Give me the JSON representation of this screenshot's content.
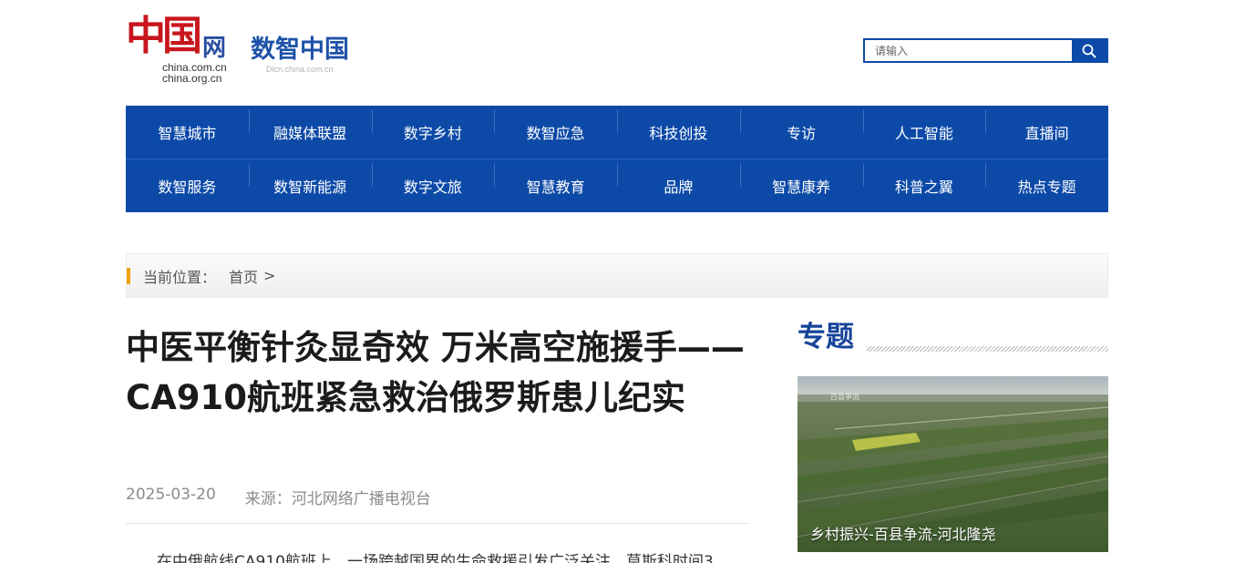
{
  "header": {
    "logo_mark": "中国",
    "logo_wang": "网",
    "domain1": "china.com.cn",
    "domain2": "china.org.cn",
    "site_name": "数智中国",
    "site_domain": "Dicn.china.com.cn"
  },
  "search": {
    "placeholder": "请输入",
    "icon": "search-icon"
  },
  "nav": {
    "row1": [
      "智慧城市",
      "融媒体联盟",
      "数字乡村",
      "数智应急",
      "科技创投",
      "专访",
      "人工智能",
      "直播间"
    ],
    "row2": [
      "数智服务",
      "数智新能源",
      "数字文旅",
      "智慧教育",
      "品牌",
      "智慧康养",
      "科普之翼",
      "热点专题"
    ]
  },
  "breadcrumb": {
    "label": "当前位置：",
    "home": "首页",
    "sep": ">"
  },
  "article": {
    "title": "中医平衡针灸显奇效 万米高空施援手——CA910航班紧急救治俄罗斯患儿纪实",
    "date": "2025-03-20",
    "source": "来源：河北网络广播电视台",
    "first_line": "在中俄航线CA910航班上，一场跨越国界的生命救援引发广泛关注。莫斯科时间3"
  },
  "sidebar": {
    "title": "专题",
    "feature": {
      "caption": "乡村振兴-百县争流-河北隆尧",
      "watermark": "百县争流"
    }
  },
  "colors": {
    "nav_bg": "#0d4aa8",
    "logo_red": "#c8161d",
    "accent_bar": "#f0a400",
    "sidebar_title": "#17449a"
  }
}
